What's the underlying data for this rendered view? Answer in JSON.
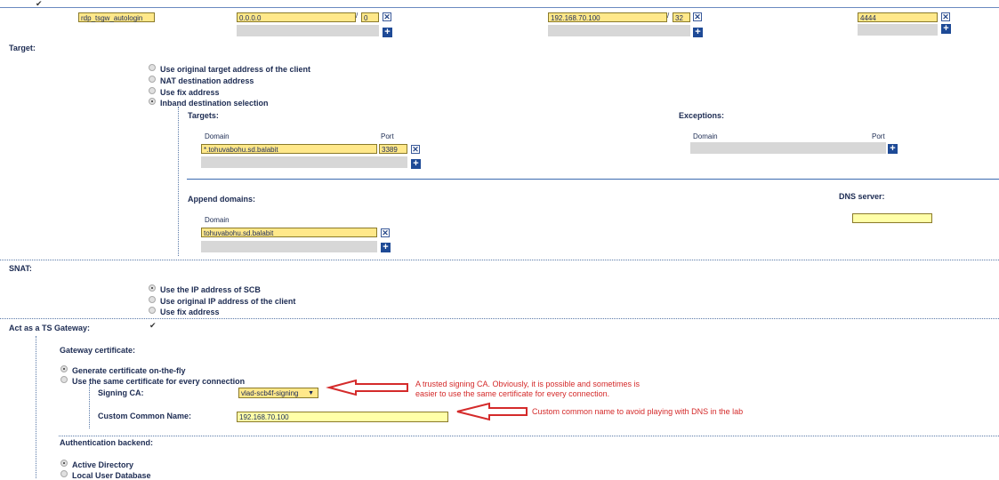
{
  "top_row": {
    "checked": true,
    "name": "rdp_tsgw_autologin",
    "source": {
      "ip": "0.0.0.0",
      "sep": "/",
      "mask": "0"
    },
    "dest": {
      "ip": "192.168.70.100",
      "sep": "/",
      "mask": "32"
    },
    "port": "4444"
  },
  "target": {
    "label": "Target:",
    "options": [
      "Use original target address of the client",
      "NAT destination address",
      "Use fix address",
      "Inband destination selection"
    ],
    "selected": 3,
    "targets_label": "Targets:",
    "exceptions_label": "Exceptions:",
    "domain_col": "Domain",
    "port_col": "Port",
    "target_domain": "*.tohuvabohu.sd.balabit",
    "target_port": "3389",
    "exc_domain_col": "Domain",
    "exc_port_col": "Port",
    "append_domains_label": "Append domains:",
    "append_domain_col": "Domain",
    "append_domain": "tohuvabohu.sd.balabit",
    "dns_server_label": "DNS server:",
    "dns_server": ""
  },
  "snat": {
    "label": "SNAT:",
    "options": [
      "Use the IP address of SCB",
      "Use original IP address of the client",
      "Use fix address"
    ],
    "selected": 0
  },
  "ts_gateway": {
    "label": "Act as a TS Gateway:",
    "checked": true,
    "gateway_cert_label": "Gateway certificate:",
    "cert_options": [
      "Generate certificate on-the-fly",
      "Use the same certificate for every connection"
    ],
    "cert_selected": 0,
    "signing_ca_label": "Signing CA:",
    "signing_ca_value": "vlad-scb4f-signing",
    "common_name_label": "Custom Common Name:",
    "common_name_value": "192.168.70.100",
    "auth_backend_label": "Authentication backend:",
    "auth_options": [
      "Active Directory",
      "Local User Database"
    ],
    "auth_selected": 0
  },
  "annotations": {
    "signing_note_line1": "A trusted signing CA. Obviously, it is possible and sometimes is",
    "signing_note_line2": "easier to use the same certificate for every connection.",
    "cn_note": "Custom common name to avoid playing with DNS in the lab"
  },
  "colors": {
    "input_bg": "#ffe88a",
    "button_blue": "#1e4a96",
    "annotation_red": "#d42a2a",
    "label_navy": "#1c2b52"
  }
}
